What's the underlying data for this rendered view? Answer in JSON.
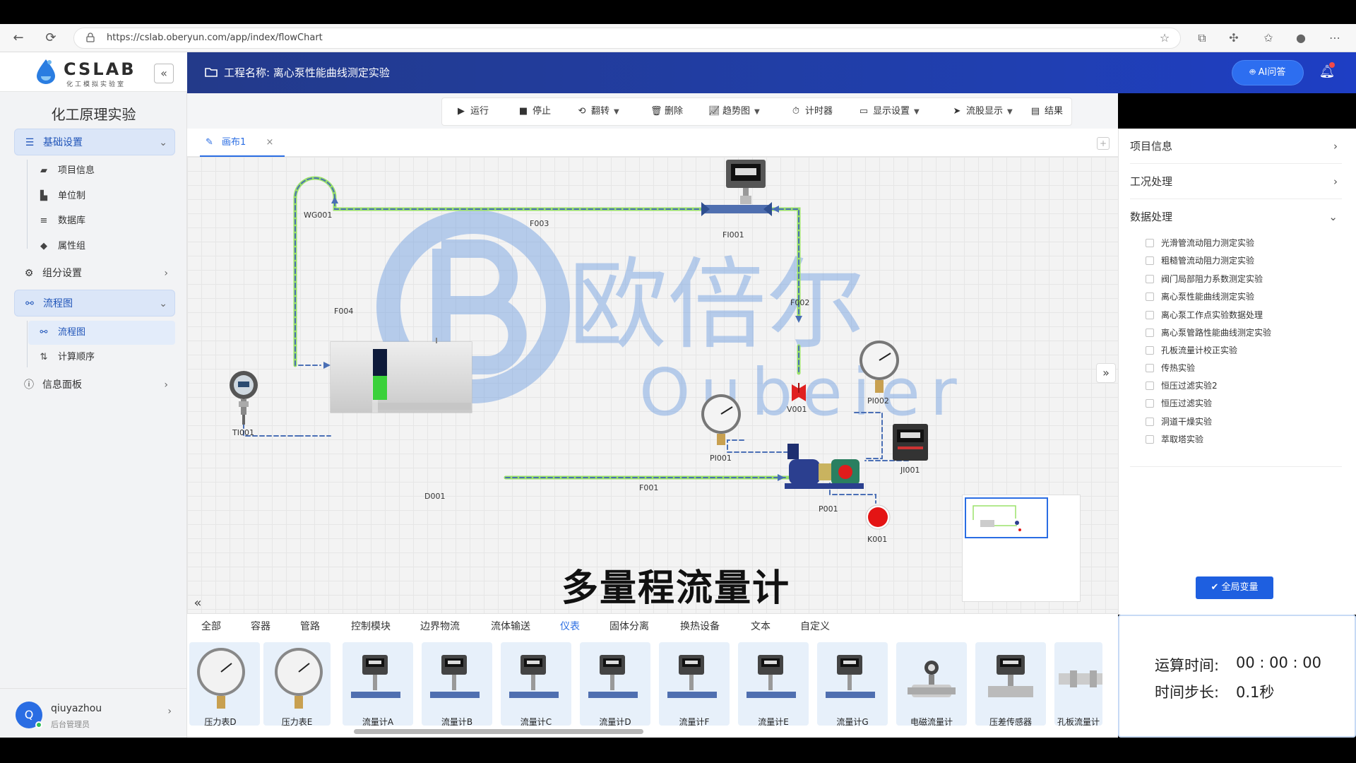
{
  "browser": {
    "url": "https://cslab.oberyun.com/app/index/flowChart"
  },
  "app": {
    "logo": "CSLAB",
    "logo_sub": "化工模拟实验室",
    "sidebar_title": "化工原理实验",
    "groups": [
      {
        "label": "基础设置",
        "icon": "sliders-icon",
        "state": "expanded"
      },
      {
        "label": "组分设置",
        "icon": "gear-icon",
        "state": "collapsed"
      },
      {
        "label": "流程图",
        "icon": "flowchart-icon",
        "state": "expanded"
      },
      {
        "label": "信息面板",
        "icon": "info-icon",
        "state": "collapsed"
      }
    ],
    "basic_items": [
      {
        "label": "项目信息",
        "icon": "folder-icon"
      },
      {
        "label": "单位制",
        "icon": "ruler-icon"
      },
      {
        "label": "数据库",
        "icon": "database-icon"
      },
      {
        "label": "属性组",
        "icon": "tag-icon"
      }
    ],
    "flow_items": [
      {
        "label": "流程图",
        "icon": "flowchart-icon",
        "active": true
      },
      {
        "label": "计算顺序",
        "icon": "sort-icon",
        "active": false
      }
    ],
    "user": {
      "initial": "Q",
      "name": "qiuyazhou",
      "role": "后台管理员"
    }
  },
  "header": {
    "project_title": "工程名称: 离心泵性能曲线测定实验",
    "ai_button": "AI问答"
  },
  "toolbar": {
    "items": [
      {
        "label": "运行",
        "icon": "play-icon",
        "dropdown": false
      },
      {
        "label": "停止",
        "icon": "stop-icon",
        "dropdown": false
      },
      {
        "label": "翻转",
        "icon": "rotate-icon",
        "dropdown": true
      },
      {
        "label": "删除",
        "icon": "trash-icon",
        "dropdown": false
      },
      {
        "label": "趋势图",
        "icon": "trend-icon",
        "dropdown": true
      },
      {
        "label": "计时器",
        "icon": "timer-icon",
        "dropdown": false
      },
      {
        "label": "显示设置",
        "icon": "monitor-icon",
        "dropdown": true
      },
      {
        "label": "流股显示",
        "icon": "send-icon",
        "dropdown": true
      },
      {
        "label": "结果",
        "icon": "document-icon",
        "dropdown": false
      }
    ]
  },
  "canvas": {
    "tab_label": "画布1",
    "caption": "多量程流量计",
    "watermark_cn": "欧倍尔",
    "watermark_en": "Oubeier",
    "labels": {
      "wg": "WG001",
      "f003": "F003",
      "fi": "FI001",
      "f004": "F004",
      "f002": "F002",
      "ti": "TI001",
      "d": "D001",
      "f001": "F001",
      "pi1": "PI001",
      "pi2": "PI002",
      "v": "V001",
      "ji": "JI001",
      "p": "P001",
      "k": "K001"
    }
  },
  "palette": {
    "categories": [
      "全部",
      "容器",
      "管路",
      "控制模块",
      "边界物流",
      "流体输送",
      "仪表",
      "固体分离",
      "换热设备",
      "文本",
      "自定义"
    ],
    "active_category": "仪表",
    "items": [
      {
        "label": "压力表D",
        "icon": "pressure-gauge-icon"
      },
      {
        "label": "压力表E",
        "icon": "pressure-gauge-icon"
      },
      {
        "label": "流量计A",
        "icon": "flowmeter-icon"
      },
      {
        "label": "流量计B",
        "icon": "flowmeter-icon"
      },
      {
        "label": "流量计C",
        "icon": "flowmeter-icon"
      },
      {
        "label": "流量计D",
        "icon": "flowmeter-icon"
      },
      {
        "label": "流量计F",
        "icon": "flowmeter-icon"
      },
      {
        "label": "流量计E",
        "icon": "flowmeter-icon"
      },
      {
        "label": "流量计G",
        "icon": "flowmeter-icon"
      },
      {
        "label": "电磁流量计",
        "icon": "electromagnetic-flowmeter-icon"
      },
      {
        "label": "压差传感器",
        "icon": "pressure-sensor-icon"
      },
      {
        "label": "孔板流量计",
        "icon": "orifice-meter-icon"
      }
    ]
  },
  "right_panel": {
    "sections": [
      {
        "label": "项目信息",
        "state": "collapsed"
      },
      {
        "label": "工况处理",
        "state": "collapsed"
      },
      {
        "label": "数据处理",
        "state": "expanded"
      }
    ],
    "data_items": [
      "光滑管流动阻力测定实验",
      "粗糙管流动阻力测定实验",
      "阀门局部阻力系数测定实验",
      "离心泵性能曲线测定实验",
      "离心泵工作点实验数据处理",
      "离心泵管路性能曲线测定实验",
      "孔板流量计校正实验",
      "传热实验",
      "恒压过滤实验2",
      "恒压过滤实验",
      "洞道干燥实验",
      "萃取塔实验"
    ],
    "global_var_button": "全局变量"
  },
  "timer": {
    "run_time_label": "运算时间:",
    "run_time_value": "00 : 00 : 00",
    "step_label": "时间步长:",
    "step_value": "0.1秒"
  },
  "colors": {
    "header_blue": "#233a8a",
    "accent": "#2a6de3",
    "pipe_green": "#9be26a",
    "pipe_dash": "#4a6fb5"
  }
}
